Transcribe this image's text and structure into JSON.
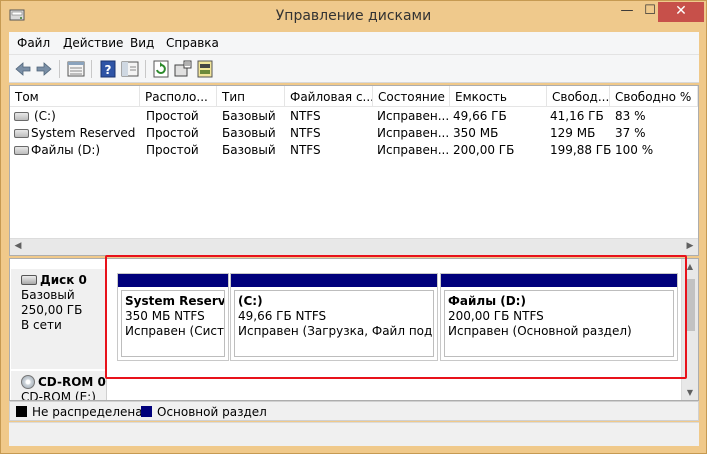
{
  "window": {
    "title": "Управление дисками",
    "min_glyph": "—",
    "max_glyph": "☐",
    "close_glyph": "✕"
  },
  "menu": [
    "Файл",
    "Действие",
    "Вид",
    "Справка"
  ],
  "toolbar": {
    "icons": [
      "back-icon",
      "forward-icon",
      "view-icon",
      "help-icon",
      "console-icon",
      "refresh-icon",
      "properties-icon",
      "disk-properties-icon"
    ]
  },
  "volume_table": {
    "columns": [
      "Том",
      "Располо...",
      "Тип",
      "Файловая с...",
      "Состояние",
      "Емкость",
      "Свобод...",
      "Свободно %"
    ],
    "rows": [
      {
        "name": "(C:)",
        "layout": "Простой",
        "type": "Базовый",
        "fs": "NTFS",
        "status": "Исправен...",
        "capacity": "49,66 ГБ",
        "free": "41,16 ГБ",
        "free_pct": "83 %"
      },
      {
        "name": "System Reserved",
        "layout": "Простой",
        "type": "Базовый",
        "fs": "NTFS",
        "status": "Исправен...",
        "capacity": "350 МБ",
        "free": "129 МБ",
        "free_pct": "37 %"
      },
      {
        "name": "Файлы (D:)",
        "layout": "Простой",
        "type": "Базовый",
        "fs": "NTFS",
        "status": "Исправен...",
        "capacity": "200,00 ГБ",
        "free": "199,88 ГБ",
        "free_pct": "100 %"
      }
    ]
  },
  "disks": [
    {
      "title": "Диск 0",
      "type": "Базовый",
      "size": "250,00 ГБ",
      "state": "В сети",
      "partitions": [
        {
          "name": "System Reserved",
          "size_fs": "350 МБ NTFS",
          "status": "Исправен (Систем"
        },
        {
          "name": "(C:)",
          "size_fs": "49,66 ГБ NTFS",
          "status": "Исправен (Загрузка, Файл подкачки"
        },
        {
          "name": "Файлы  (D:)",
          "size_fs": "200,00 ГБ NTFS",
          "status": "Исправен (Основной раздел)"
        }
      ]
    },
    {
      "title": "CD-ROM 0",
      "subtitle": "CD-ROM (E:)"
    }
  ],
  "legend": [
    {
      "label": "Не распределена",
      "color": "#000000"
    },
    {
      "label": "Основной раздел",
      "color": "#00007b"
    }
  ],
  "colors": {
    "partition_bar": "#00007b",
    "highlight": "#e8121b",
    "title_bar": "#efc98c"
  }
}
